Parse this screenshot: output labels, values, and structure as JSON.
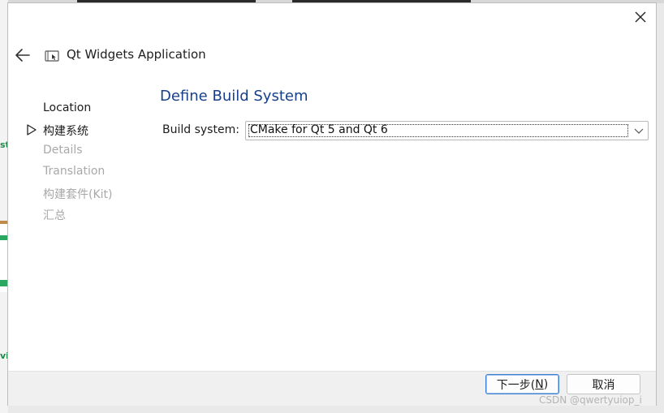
{
  "window": {
    "title": "Qt Widgets Application",
    "icons": {
      "back": "arrow-left",
      "app": "window-cursor",
      "close": "close-x"
    }
  },
  "steps": [
    {
      "label": "Location",
      "state": "done"
    },
    {
      "label": "构建系统",
      "state": "current"
    },
    {
      "label": "Details",
      "state": "pending"
    },
    {
      "label": "Translation",
      "state": "pending"
    },
    {
      "label": "构建套件(Kit)",
      "state": "pending"
    },
    {
      "label": "汇总",
      "state": "pending"
    }
  ],
  "page": {
    "title": "Define Build System",
    "build_system_label": "Build system:",
    "build_system_value": "CMake for Qt 5 and Qt 6"
  },
  "buttons": {
    "next_label": "下一步(",
    "next_mnemonic": "N",
    "next_suffix": ")",
    "cancel_label": "取消"
  },
  "watermark": "CSDN @qwertyuiop_i",
  "background": {
    "peek_s": "st",
    "peek_v": "vi"
  },
  "colors": {
    "page_title": "#173f8a",
    "disabled_text": "#a8a8a8",
    "focus_border": "#3c7fd1"
  }
}
